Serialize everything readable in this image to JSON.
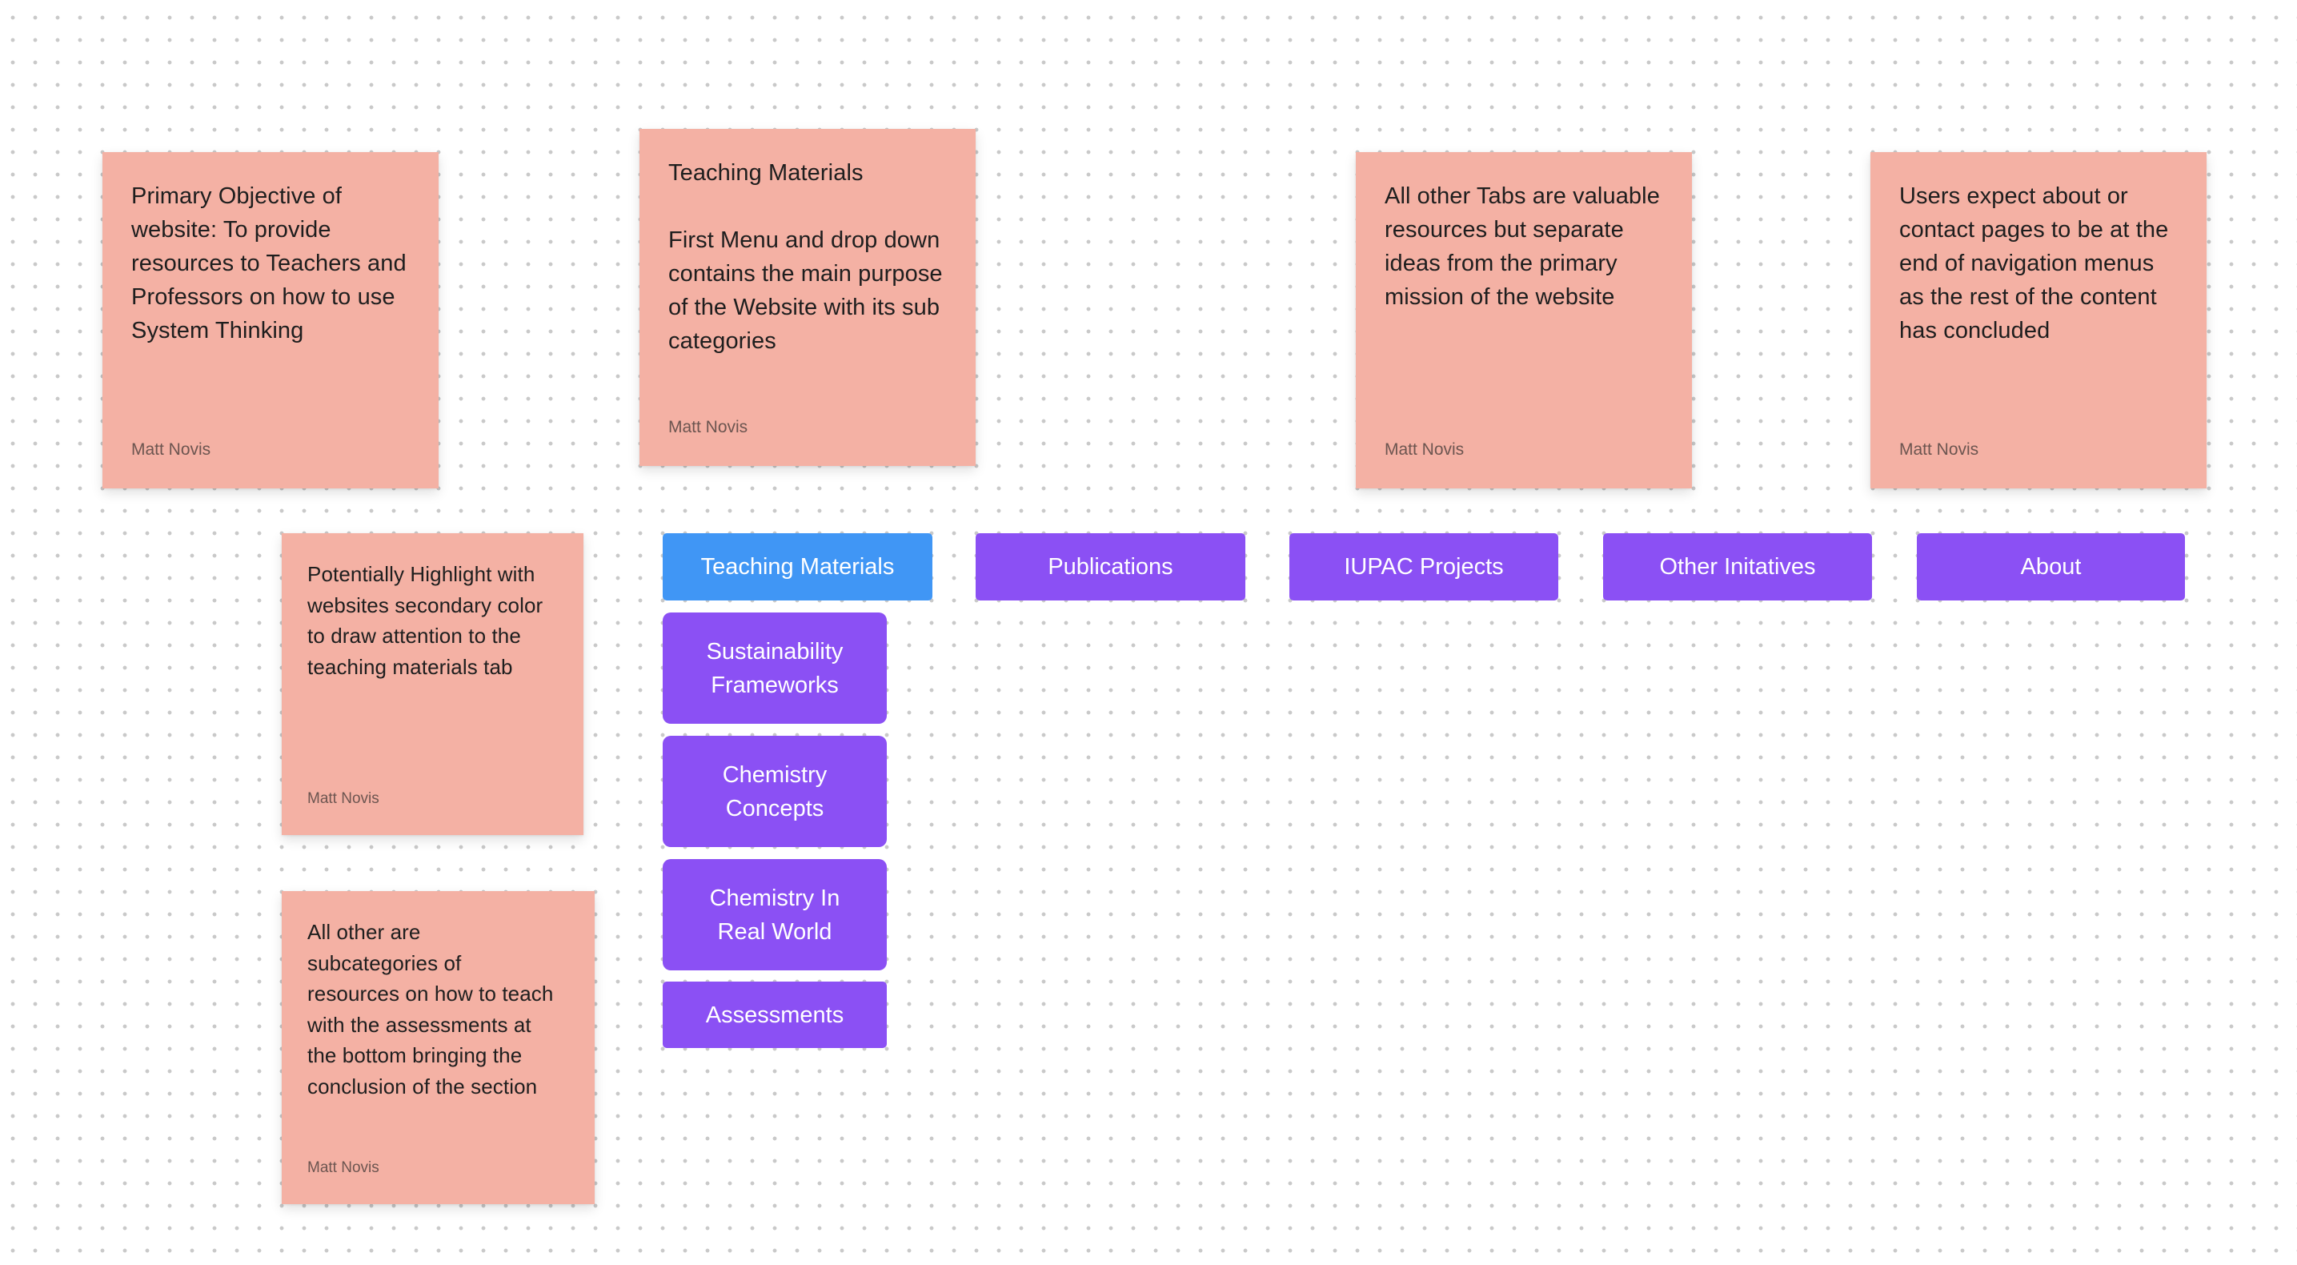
{
  "colors": {
    "sticky": "#f4b1a4",
    "nav_default": "#8b50f4",
    "nav_active": "#4096f5",
    "canvas": "#ffffff"
  },
  "stickies": [
    {
      "id": "primary-objective",
      "text": "Primary Objective of\nwebsite: To provide\nresources to Teachers and\nProfessors on how to use\nSystem Thinking",
      "author": "Matt Novis"
    },
    {
      "id": "teaching-materials",
      "text": "Teaching Materials\n\nFirst Menu and drop down\ncontains the main purpose\nof the Website with its sub\ncategories",
      "author": "Matt Novis"
    },
    {
      "id": "other-tabs",
      "text": "All other Tabs are valuable\nresources but separate\nideas from the primary\nmission of the website",
      "author": "Matt Novis"
    },
    {
      "id": "about-contact",
      "text": "Users expect about or\ncontact pages to be at the\nend of navigation menus\nas the rest of the content\nhas concluded",
      "author": "Matt Novis"
    },
    {
      "id": "highlight",
      "text": "Potentially Highlight with\nwebsites secondary color\nto draw attention to the\nteaching materials tab",
      "author": "Matt Novis"
    },
    {
      "id": "subcategories",
      "text": "All other are\nsubcategories of\nresources on how to teach\nwith the assessments at\nthe bottom bringing the\nconclusion of the section",
      "author": "Matt Novis"
    }
  ],
  "nav": {
    "items": [
      {
        "label": "Teaching Materials",
        "active": true
      },
      {
        "label": "Publications",
        "active": false
      },
      {
        "label": "IUPAC Projects",
        "active": false
      },
      {
        "label": "Other Initatives",
        "active": false
      },
      {
        "label": "About",
        "active": false
      }
    ],
    "dropdown": [
      {
        "label": "Sustainability\nFrameworks"
      },
      {
        "label": "Chemistry\nConcepts"
      },
      {
        "label": "Chemistry In\nReal World"
      },
      {
        "label": "Assessments"
      }
    ]
  }
}
